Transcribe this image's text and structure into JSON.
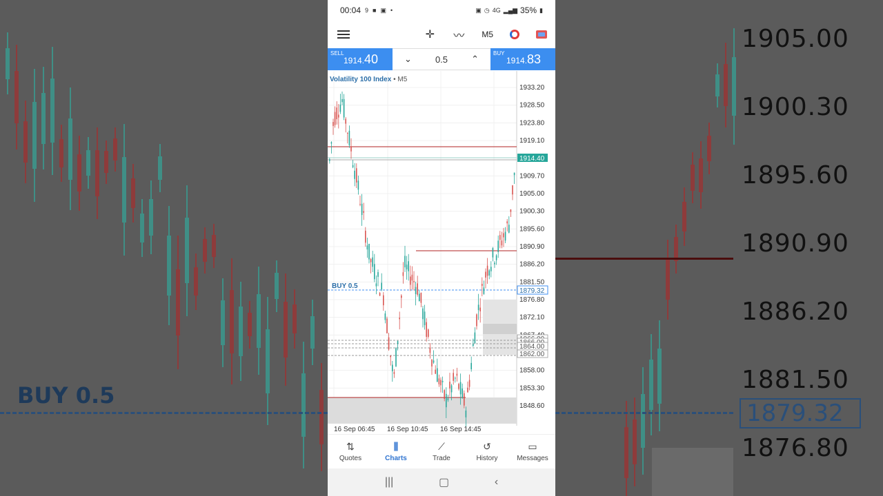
{
  "status": {
    "time": "00:04",
    "battery": "35%",
    "network": "4G"
  },
  "toolbar": {
    "timeframe": "M5",
    "menu_icon": "hamburger-icon",
    "crosshair_icon": "crosshair-icon",
    "indicator_icon": "indicator-icon",
    "objects_icon": "color-circle-icon",
    "trade_icon": "one-click-trading-icon"
  },
  "trade": {
    "sell_label": "SELL",
    "sell_price_main": "1914.",
    "sell_price_big": "40",
    "buy_label": "BUY",
    "buy_price_main": "1914.",
    "buy_price_big": "83",
    "volume": "0.5"
  },
  "chart": {
    "symbol": "Volatility 100 Index",
    "timeframe": "• M5",
    "position_label": "BUY 0.5",
    "position_price": "1879.32",
    "current_price": "1914.40",
    "price_labels": [
      "1933.20",
      "1928.50",
      "1923.80",
      "1919.10",
      "1909.70",
      "1905.00",
      "1900.30",
      "1895.60",
      "1890.90",
      "1886.20",
      "1881.50",
      "1876.80",
      "1872.10",
      "1867.40",
      "1858.00",
      "1853.30",
      "1848.60"
    ],
    "box_labels": [
      "1866.00",
      "1866.00",
      "1864.00",
      "1862.00"
    ],
    "time_labels": [
      "16 Sep 06:45",
      "16 Sep 10:45",
      "16 Sep 14:45"
    ]
  },
  "nav": [
    {
      "label": "Quotes",
      "icon": "arrows-updown-icon"
    },
    {
      "label": "Charts",
      "icon": "candles-icon",
      "active": true
    },
    {
      "label": "Trade",
      "icon": "trend-line-icon"
    },
    {
      "label": "History",
      "icon": "history-icon"
    },
    {
      "label": "Messages",
      "icon": "messages-icon"
    }
  ],
  "background": {
    "price_labels": [
      "1905.00",
      "1900.30",
      "1895.60",
      "1890.90",
      "1886.20",
      "1881.50",
      "1876.80"
    ],
    "buy_label": "BUY 0.5",
    "position_price": "1879.32"
  },
  "colors": {
    "bull": "#26a69a",
    "bear": "#d9534f",
    "accent": "#3c8ef0",
    "redline": "#b22222"
  }
}
